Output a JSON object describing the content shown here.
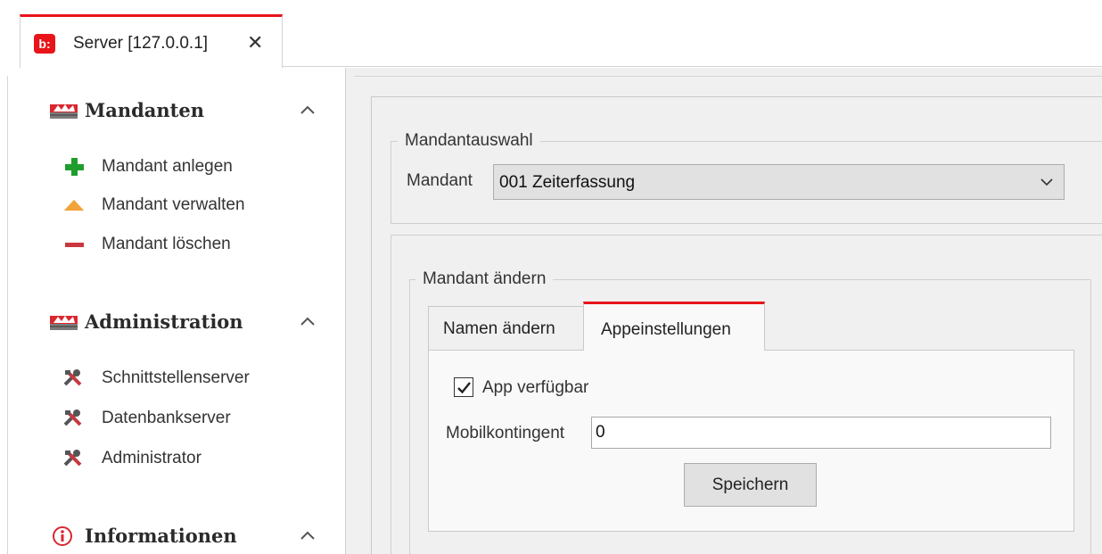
{
  "window_tab": {
    "logo": "b:",
    "title": "Server [127.0.0.1]",
    "close": "✕"
  },
  "sidebar": {
    "sections": [
      {
        "title": "Mandanten",
        "icon": "mandanten-icon",
        "items": [
          {
            "label": "Mandant anlegen",
            "icon": "plus-icon"
          },
          {
            "label": "Mandant verwalten",
            "icon": "triangle-icon"
          },
          {
            "label": "Mandant löschen",
            "icon": "minus-icon"
          }
        ]
      },
      {
        "title": "Administration",
        "icon": "administration-icon",
        "items": [
          {
            "label": "Schnittstellenserver",
            "icon": "tools-icon"
          },
          {
            "label": "Datenbankserver",
            "icon": "tools-icon"
          },
          {
            "label": "Administrator",
            "icon": "tools-icon"
          }
        ]
      },
      {
        "title": "Informationen",
        "icon": "info-icon",
        "items": []
      }
    ]
  },
  "main": {
    "selection_group": {
      "title": "Mandantauswahl",
      "field_label": "Mandant",
      "selected_value": "001 Zeiterfassung"
    },
    "edit_group": {
      "title": "Mandant ändern",
      "tabs": [
        {
          "label": "Namen ändern",
          "active": false
        },
        {
          "label": "Appeinstellungen",
          "active": true
        }
      ],
      "app_available": {
        "label": "App verfügbar",
        "checked": true
      },
      "mobile_quota": {
        "label": "Mobilkontingent",
        "value": "0"
      },
      "save_label": "Speichern"
    }
  },
  "colors": {
    "accent": "#e8141a",
    "plus": "#1f9e2e",
    "triangle": "#f2a33a",
    "minus": "#c9383f"
  }
}
